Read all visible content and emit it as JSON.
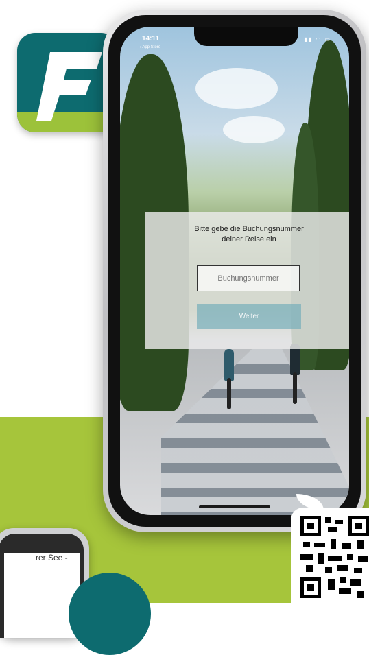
{
  "app": {
    "icon_letter": "F",
    "colors": {
      "teal": "#0d6b6f",
      "green": "#9cc23a",
      "button": "#6eaab9"
    }
  },
  "status_bar": {
    "time": "14:11",
    "back_label": "◂ App Store",
    "icons": "▮▮ ◠ ▭"
  },
  "dialog": {
    "title_line1": "Bitte gebe die Buchungsnummer",
    "title_line2": "deiner Reise ein",
    "input_placeholder": "Buchungsnummer",
    "button_label": "Weiter"
  },
  "secondary_phone": {
    "visible_text": "rer See -"
  }
}
